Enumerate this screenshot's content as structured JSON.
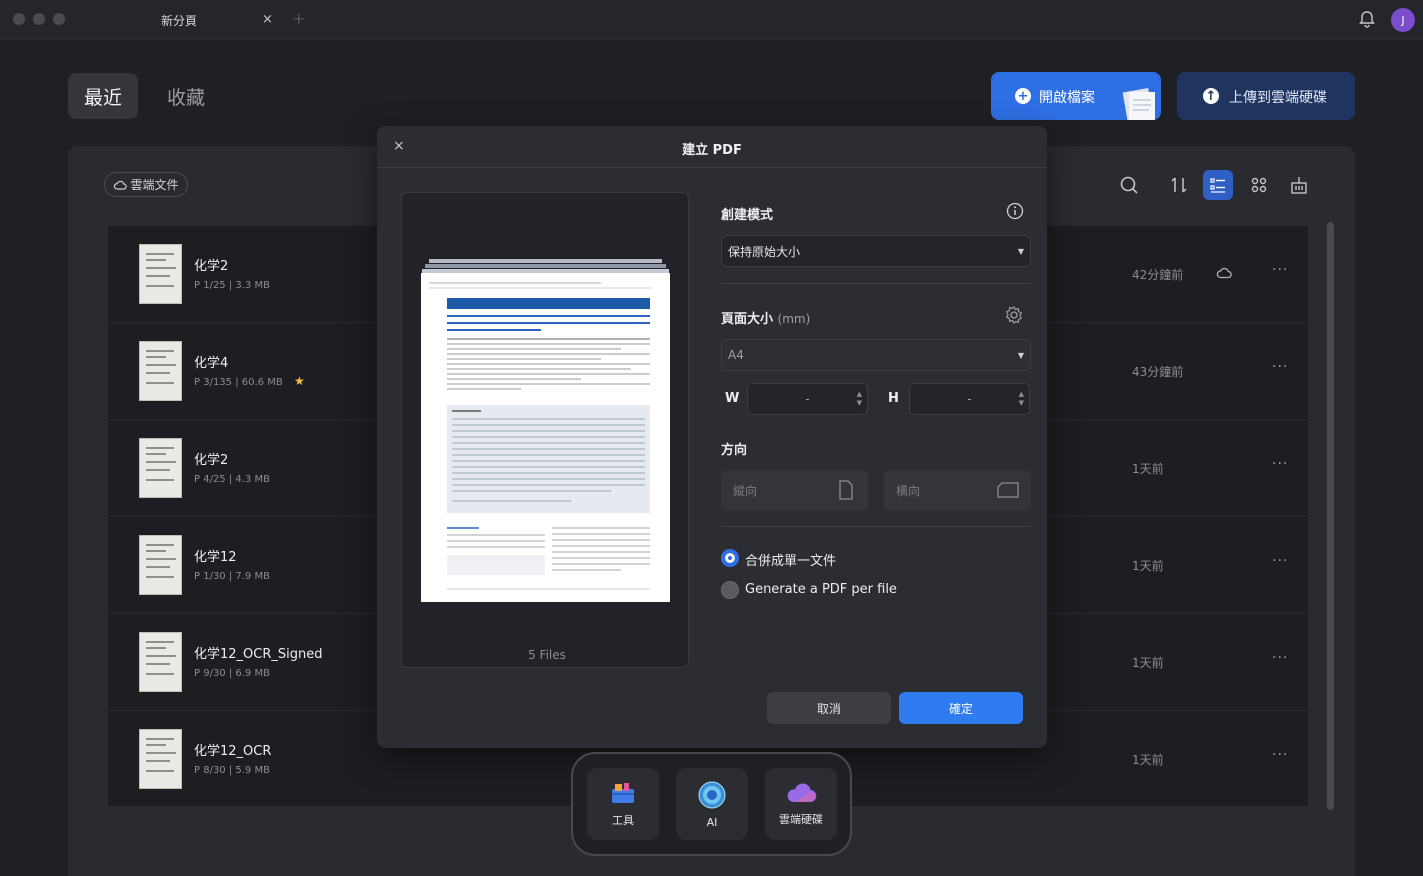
{
  "window": {
    "tab_title": "新分頁",
    "tab_close": "×",
    "new_tab": "+",
    "avatar_letter": "J"
  },
  "nav": {
    "recent": "最近",
    "favorites": "收藏"
  },
  "actions": {
    "open_file": "開啟檔案",
    "upload_cloud": "上傳到雲端硬碟"
  },
  "panel": {
    "cloud_docs": "雲端文件"
  },
  "files": [
    {
      "name": "化学2",
      "meta": "P 1/25 | 3.3 MB",
      "time": "42分鐘前",
      "cloud": true,
      "starred": false
    },
    {
      "name": "化学4",
      "meta": "P 3/135 | 60.6 MB",
      "time": "43分鐘前",
      "cloud": false,
      "starred": true
    },
    {
      "name": "化学2",
      "meta": "P 4/25 | 4.3 MB",
      "time": "1天前",
      "cloud": false,
      "starred": false
    },
    {
      "name": "化学12",
      "meta": "P 1/30 | 7.9 MB",
      "time": "1天前",
      "cloud": false,
      "starred": false
    },
    {
      "name": "化学12_OCR_Signed",
      "meta": "P 9/30 | 6.9 MB",
      "time": "1天前",
      "cloud": false,
      "starred": false
    },
    {
      "name": "化学12_OCR",
      "meta": "P 8/30 | 5.9 MB",
      "time": "1天前",
      "cloud": false,
      "starred": false
    }
  ],
  "row_more": "···",
  "dialog": {
    "close": "×",
    "title": "建立 PDF",
    "preview_count": "5 Files",
    "create_mode_label": "創建模式",
    "create_mode_value": "保持原始大小",
    "page_size_label": "頁面大小",
    "page_size_unit": "(mm)",
    "page_size_value": "A4",
    "w_label": "W",
    "w_value": "-",
    "h_label": "H",
    "h_value": "-",
    "orientation_label": "方向",
    "portrait": "縱向",
    "landscape": "橫向",
    "merge_option": "合併成單一文件",
    "per_file_option": "Generate a PDF per file",
    "cancel": "取消",
    "confirm": "確定"
  },
  "dock": {
    "tools": "工具",
    "ai": "AI",
    "cloud_drive": "雲端硬碟"
  },
  "colors": {
    "accent": "#2f6fe4",
    "background": "#1f2024",
    "panel": "#2a2b30",
    "dialog": "#2c2d33"
  }
}
